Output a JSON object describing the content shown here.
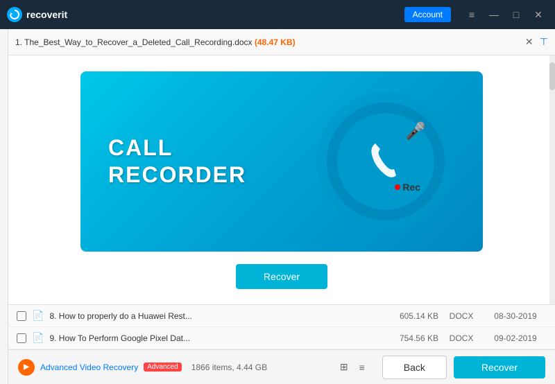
{
  "titlebar": {
    "logo_text": "recoverit",
    "account_label": "Account",
    "minimize_icon": "—",
    "restore_icon": "□",
    "close_icon": "✕",
    "hamburger_icon": "≡"
  },
  "searchbar": {
    "file_path": "1. The_Best_Way_to_Recover_a_Deleted_Call_Recording.docx",
    "file_size": "(48.47 KB)",
    "filter_icon": "⊤"
  },
  "preview": {
    "banner_text_line1": "CALL",
    "banner_text_line2": "RECORDER",
    "recover_button": "Recover"
  },
  "file_list": {
    "items": [
      {
        "index": "8.",
        "name": "How to properly do a Huawei Rest...",
        "size": "605.14  KB",
        "type": "DOCX",
        "date": "08-30-2019"
      },
      {
        "index": "9.",
        "name": "How To Perform Google Pixel Dat...",
        "size": "754.56  KB",
        "type": "DOCX",
        "date": "09-02-2019"
      }
    ],
    "item_count": "1866 items, 4.44 GB"
  },
  "bottom_bar": {
    "adv_video_label": "Advanced Video Recovery",
    "adv_badge": "Advanced",
    "back_button": "Back",
    "recover_button": "Recover"
  }
}
